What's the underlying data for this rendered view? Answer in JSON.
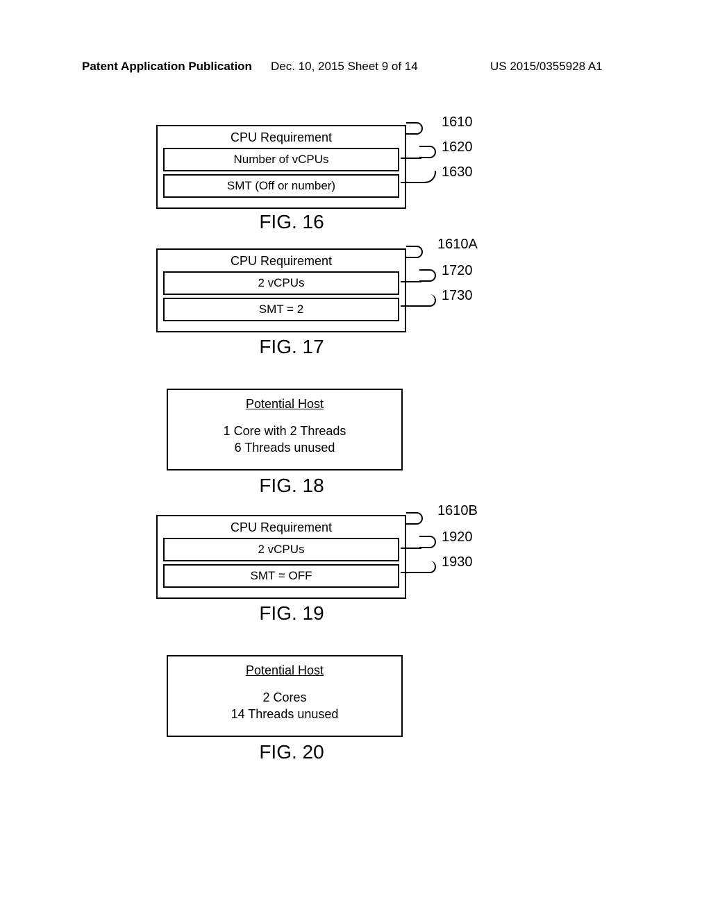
{
  "header": {
    "left": "Patent Application Publication",
    "mid": "Dec. 10, 2015  Sheet 9 of 14",
    "right": "US 2015/0355928 A1"
  },
  "fig16": {
    "title": "CPU Requirement",
    "row1": "Number of vCPUs",
    "row2": "SMT (Off or number)",
    "label": "FIG. 16",
    "ref_outer": "1610",
    "ref_r1": "1620",
    "ref_r2": "1630"
  },
  "fig17": {
    "title": "CPU Requirement",
    "row1": "2 vCPUs",
    "row2": "SMT = 2",
    "label": "FIG. 17",
    "ref_outer": "1610A",
    "ref_r1": "1720",
    "ref_r2": "1730"
  },
  "fig18": {
    "title": "Potential Host",
    "line1": "1 Core with 2 Threads",
    "line2": "6 Threads unused",
    "label": "FIG. 18"
  },
  "fig19": {
    "title": "CPU Requirement",
    "row1": "2 vCPUs",
    "row2": "SMT = OFF",
    "label": "FIG. 19",
    "ref_outer": "1610B",
    "ref_r1": "1920",
    "ref_r2": "1930"
  },
  "fig20": {
    "title": "Potential Host",
    "line1": "2 Cores",
    "line2": "14 Threads unused",
    "label": "FIG. 20"
  }
}
